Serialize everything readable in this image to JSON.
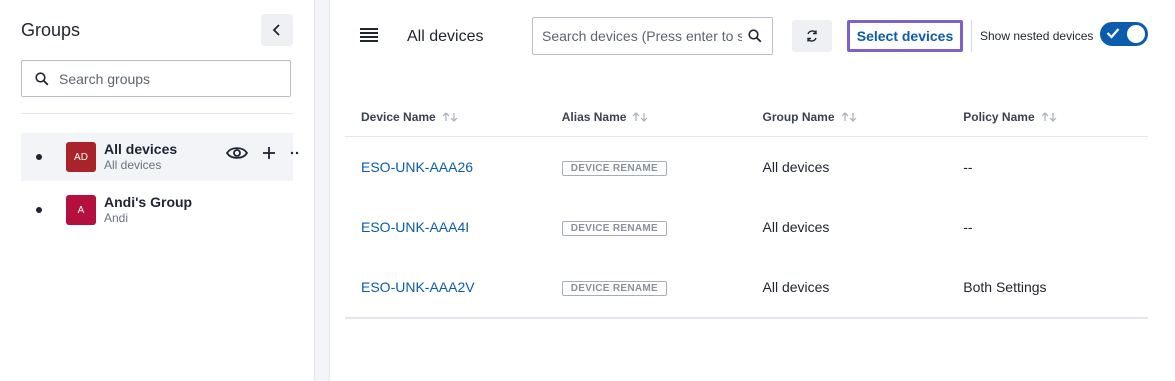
{
  "sidebar": {
    "title": "Groups",
    "search_placeholder": "Search groups",
    "groups": [
      {
        "initials": "AD",
        "name": "All devices",
        "subtitle": "All devices",
        "color": "#a8232a"
      },
      {
        "initials": "A",
        "name": "Andi's Group",
        "subtitle": "Andi",
        "color": "#b3103e"
      }
    ]
  },
  "header": {
    "title": "All devices",
    "search_placeholder": "Search devices (Press enter to search)",
    "select_devices_label": "Select devices",
    "nested_label": "Show nested devices",
    "nested_enabled": true
  },
  "table": {
    "columns": [
      "Device Name",
      "Alias Name",
      "Group Name",
      "Policy Name"
    ],
    "rows": [
      {
        "device": "ESO-UNK-AAA26",
        "alias": "DEVICE RENAME",
        "group": "All devices",
        "policy": "--"
      },
      {
        "device": "ESO-UNK-AAA4I",
        "alias": "DEVICE RENAME",
        "group": "All devices",
        "policy": "--"
      },
      {
        "device": "ESO-UNK-AAA2V",
        "alias": "DEVICE RENAME",
        "group": "All devices",
        "policy": "Both Settings"
      }
    ]
  },
  "colors": {
    "accent": "#0b5cad",
    "highlight_border": "#7b61c9"
  }
}
